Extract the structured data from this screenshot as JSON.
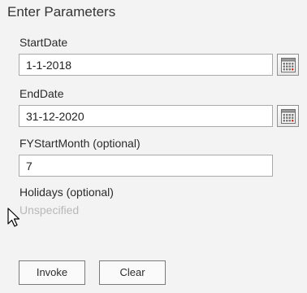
{
  "dialog": {
    "title": "Enter Parameters"
  },
  "params": {
    "start_date": {
      "label": "StartDate",
      "value": "1-1-2018"
    },
    "end_date": {
      "label": "EndDate",
      "value": "31-12-2020"
    },
    "fy_start_month": {
      "label": "FYStartMonth (optional)",
      "value": "7"
    },
    "holidays": {
      "label": "Holidays (optional)",
      "placeholder": "Unspecified"
    }
  },
  "buttons": {
    "invoke": "Invoke",
    "clear": "Clear"
  },
  "icons": {
    "calendar": "calendar-icon",
    "cursor": "mouse-pointer-icon"
  }
}
